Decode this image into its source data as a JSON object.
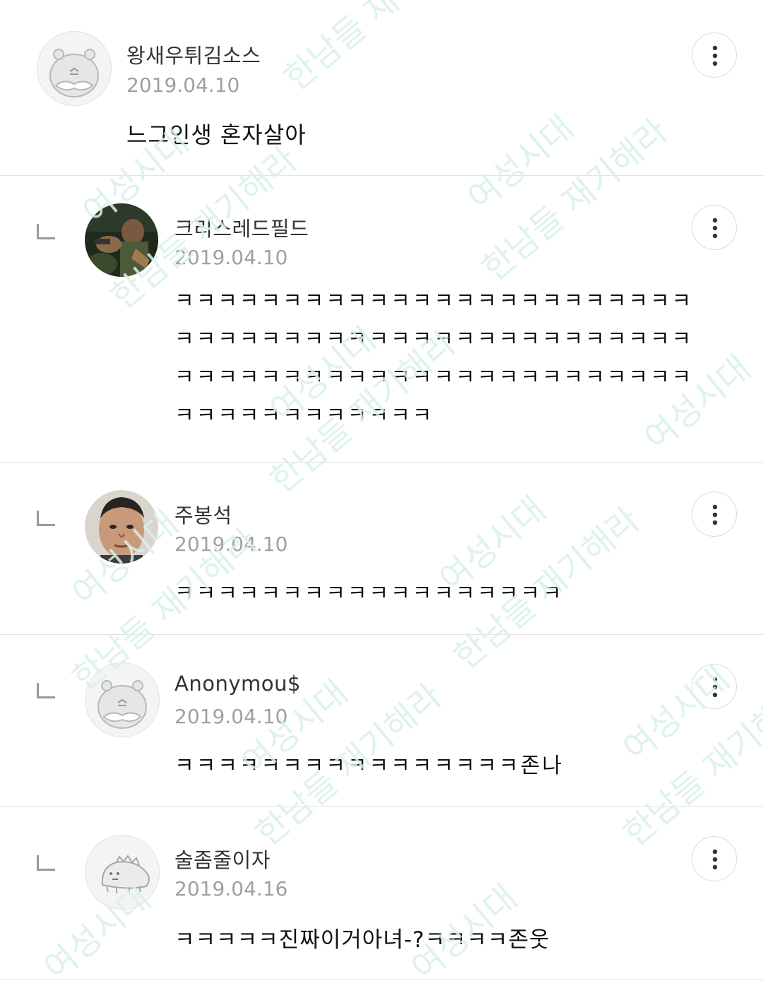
{
  "comments": [
    {
      "author": "왕새우튀김소스",
      "date": "2019.04.10",
      "body": "느그인생 혼자살아",
      "is_reply": false,
      "avatar": "hamster-mustache-avatar"
    },
    {
      "author": "크리스레드필드",
      "date": "2019.04.10",
      "body_lines": [
        "ㅋㅋㅋㅋㅋㅋㅋㅋㅋㅋㅋㅋㅋㅋㅋㅋㅋㅋㅋㅋㅋㅋㅋㅋ",
        "ㅋㅋㅋㅋㅋㅋㅋㅋㅋㅋㅋㅋㅋㅋㅋㅋㅋㅋㅋㅋㅋㅋㅋㅋ",
        "ㅋㅋㅋㅋㅋㅋㅋㅋㅋㅋㅋㅋㅋㅋㅋㅋㅋㅋㅋㅋㅋㅋㅋㅋ",
        "ㅋㅋㅋㅋㅋㅋㅋㅋㅋㅋㅋㅋ"
      ],
      "is_reply": true,
      "avatar": "game-character-photo-avatar"
    },
    {
      "author": "주봉석",
      "date": "2019.04.10",
      "body": "ㅋㅋㅋㅋㅋㅋㅋㅋㅋㅋㅋㅋㅋㅋㅋㅋㅋㅋ",
      "is_reply": true,
      "avatar": "man-face-photo-avatar"
    },
    {
      "author": "Anonymou$",
      "date": "2019.04.10",
      "body": "ㅋㅋㅋㅋㅋㅋㅋㅋㅋㅋㅋㅋㅋㅋㅋㅋ존나",
      "is_reply": true,
      "avatar": "hamster-mustache-avatar"
    },
    {
      "author": "술좀줄이자",
      "date": "2019.04.16",
      "body": "ㅋㅋㅋㅋㅋ진짜이거아녀-?ㅋㅋㅋㅋ존웃",
      "is_reply": true,
      "avatar": "dinosaur-sketch-avatar"
    }
  ],
  "icons": {
    "more": "more-vertical-icon",
    "reply": "reply-corner-icon"
  },
  "watermark": {
    "text_1": "여성시대",
    "text_2": "한남들 재기해라"
  },
  "colors": {
    "date_gray": "#a0a0a0",
    "divider": "#e3e3e3",
    "watermark": "#d8f1ea"
  }
}
